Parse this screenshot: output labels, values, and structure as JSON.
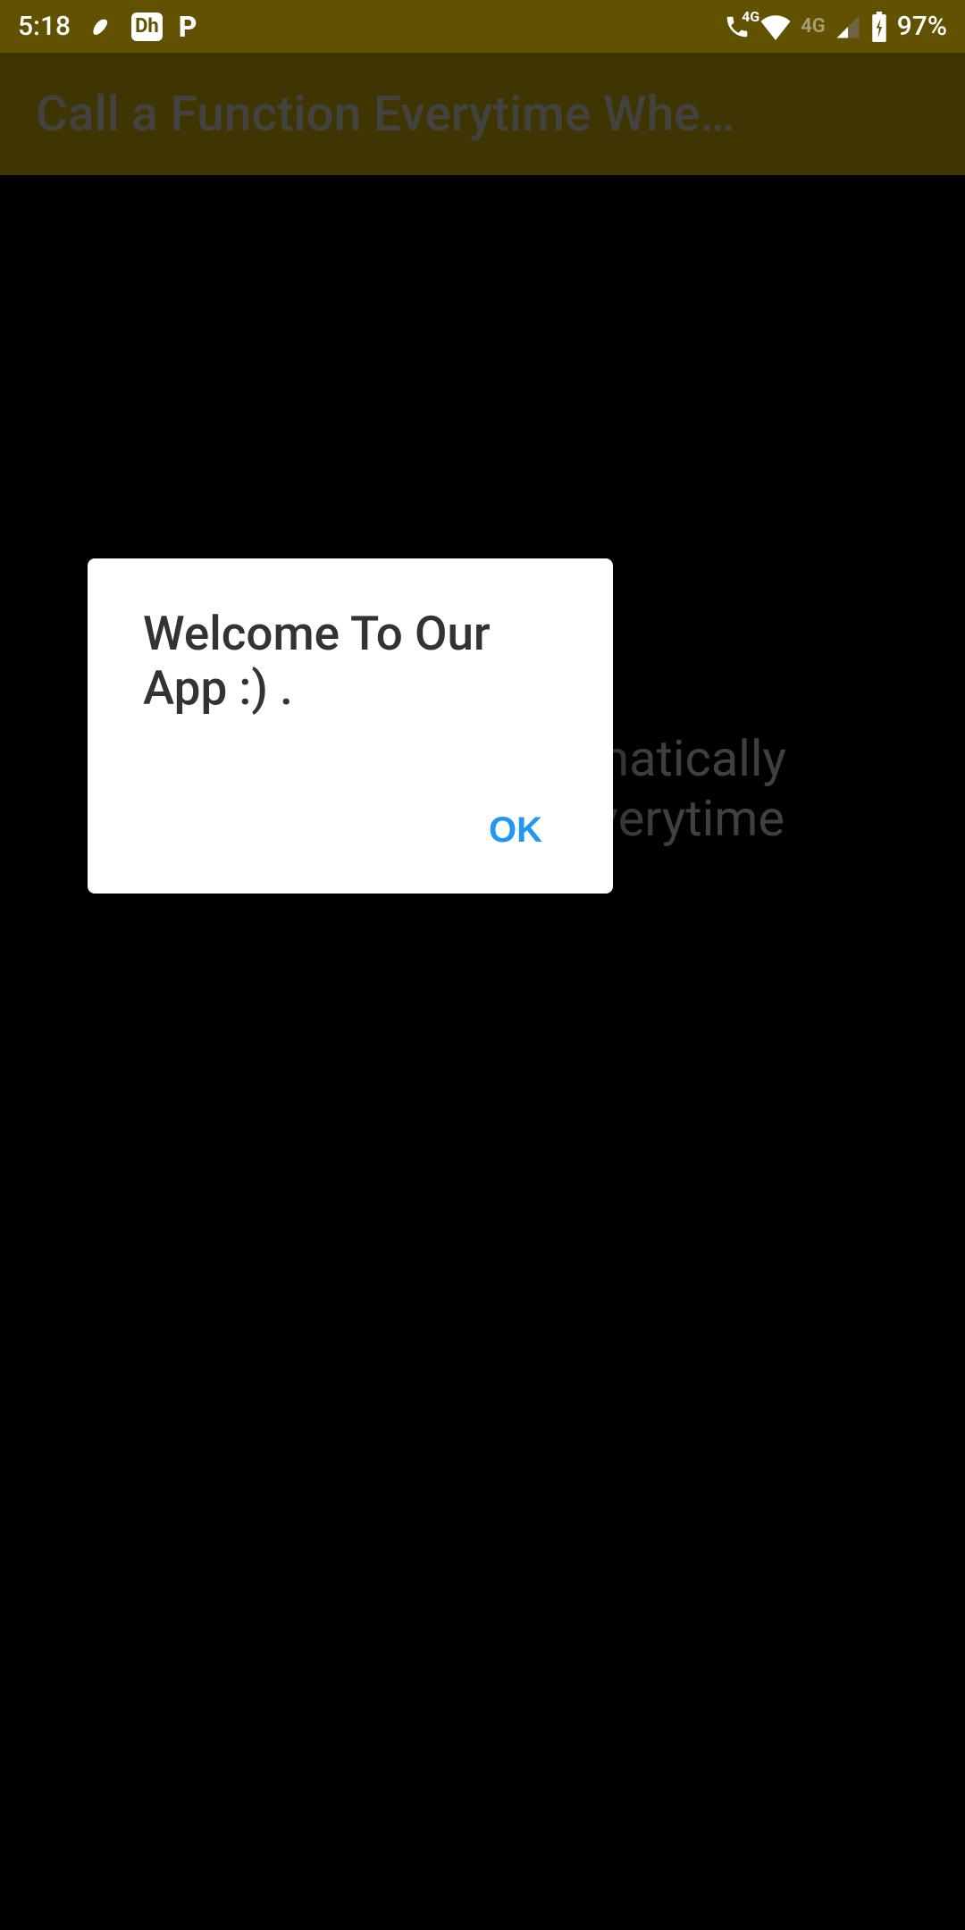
{
  "status": {
    "time": "5:18",
    "icons": {
      "airtel": "airtel",
      "disney": "Dh",
      "p": "P",
      "call4g": "4G",
      "wifi": "wifi",
      "net4g": "4G",
      "signal": "signal",
      "battery": "battery"
    },
    "battery_pct": "97%"
  },
  "appbar": {
    "title": "Call a Function Everytime Whe…"
  },
  "background": {
    "text_line1": "Call Function Automatically",
    "text_line2": "When App Starts Everytime"
  },
  "dialog": {
    "message": "Welcome To Our App :) .",
    "ok_label": "OK"
  }
}
